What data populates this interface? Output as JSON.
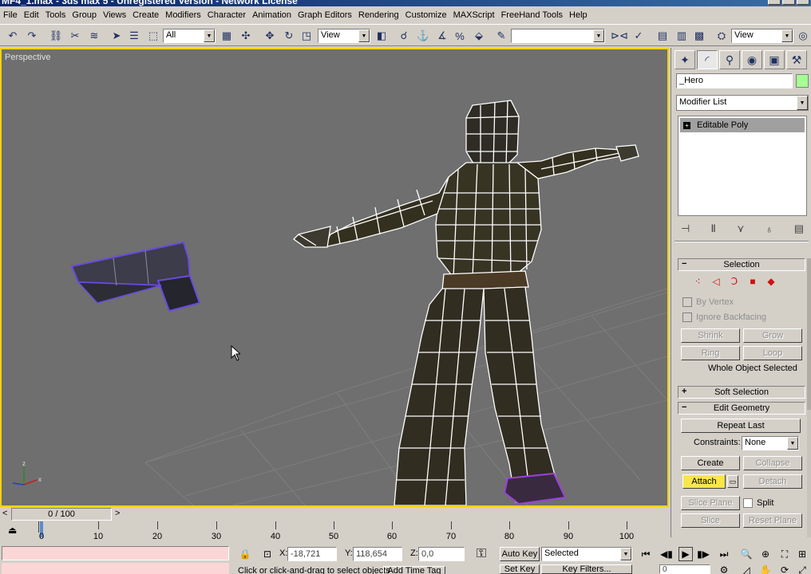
{
  "window": {
    "title": "MF4_1.max - 3ds max 5 - Unregistered Version - Network License"
  },
  "menu": [
    "File",
    "Edit",
    "Tools",
    "Group",
    "Views",
    "Create",
    "Modifiers",
    "Character",
    "Animation",
    "Graph Editors",
    "Rendering",
    "Customize",
    "MAXScript",
    "FreeHand Tools",
    "Help"
  ],
  "toolbar": {
    "selection_filter": "All",
    "ref_coord": "View",
    "named_selection": "",
    "render_view": "View"
  },
  "viewport": {
    "label": "Perspective"
  },
  "command_panel": {
    "object_name": "_Hero",
    "object_color": "#a6ff94",
    "modifier_list": "Modifier List",
    "stack_item": "Editable Poly",
    "selection": {
      "header": "Selection",
      "by_vertex": "By Vertex",
      "ignore_backfacing": "Ignore Backfacing",
      "shrink": "Shrink",
      "grow": "Grow",
      "ring": "Ring",
      "loop": "Loop",
      "status": "Whole Object Selected"
    },
    "soft_selection": {
      "header": "Soft Selection"
    },
    "edit_geometry": {
      "header": "Edit Geometry",
      "repeat_last": "Repeat Last",
      "constraints_label": "Constraints:",
      "constraints_value": "None",
      "create": "Create",
      "collapse": "Collapse",
      "attach": "Attach",
      "detach": "Detach",
      "slice_plane": "Slice Plane",
      "split": "Split",
      "slice": "Slice",
      "reset_plane": "Reset Plane"
    }
  },
  "timeline": {
    "frame_display": "0 / 100",
    "ticks": [
      "0",
      "10",
      "20",
      "30",
      "40",
      "50",
      "60",
      "70",
      "80",
      "90",
      "100"
    ]
  },
  "status": {
    "x_label": "X:",
    "x_value": "-18,721",
    "y_label": "Y:",
    "y_value": "118,654",
    "z_label": "Z:",
    "z_value": "0,0",
    "prompt": "Click or click-and-drag to select objects",
    "add_time_tag": "Add Time Tag",
    "auto_key": "Auto Key",
    "key_mode": "Selected",
    "set_key": "Set Key",
    "key_filters": "Key Filters...",
    "current_frame": "0"
  }
}
